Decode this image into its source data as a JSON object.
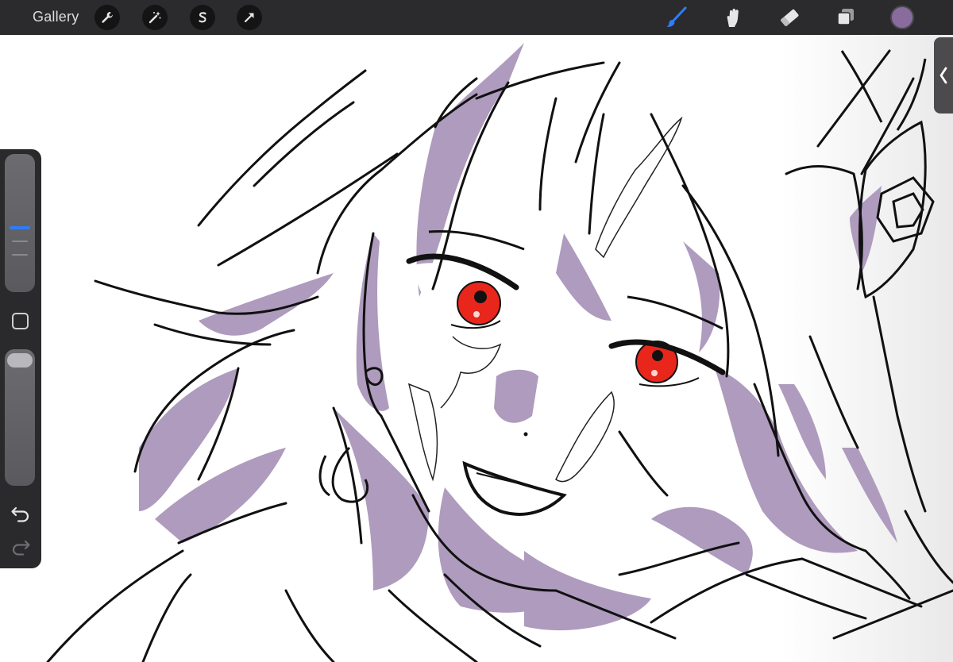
{
  "topbar": {
    "gallery_label": "Gallery",
    "left_tools": [
      "wrench-icon",
      "magic-wand-icon",
      "selection-s-icon",
      "transform-arrow-icon"
    ],
    "right_tools": [
      "brush-icon",
      "smudge-icon",
      "eraser-icon",
      "layers-icon"
    ],
    "active_tool": "brush-icon",
    "current_color": "#8a6b9e"
  },
  "sidebar": {
    "brush_size_level": 0.45,
    "opacity_level": 0.95
  },
  "colors": {
    "toolbar_bg": "#2b2b2d",
    "accent_blue": "#2f7df6",
    "shadow_purple": "#ae9bbd",
    "eye_red": "#e8261c",
    "line_black": "#111111"
  }
}
